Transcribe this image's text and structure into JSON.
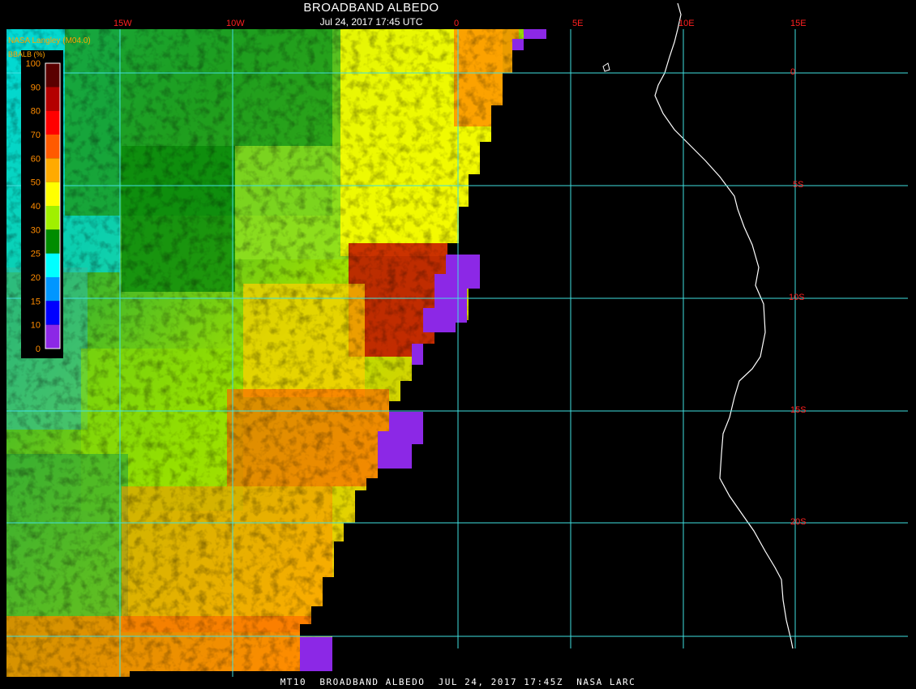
{
  "header": {
    "title": "BROADBAND ALBEDO",
    "timestamp": "Jul 24, 2017 17:45 UTC"
  },
  "credit": "NASA Langley (M04.0)",
  "footer": "MT10  BROADBAND ALBEDO  JUL 24, 2017 17:45Z  NASA LARC",
  "legend": {
    "title": "BBALB (%)",
    "ticks": [
      "100",
      "90",
      "80",
      "70",
      "60",
      "50",
      "40",
      "30",
      "25",
      "20",
      "15",
      "10",
      "0"
    ],
    "colors": [
      "#5a0000",
      "#b40000",
      "#ff0000",
      "#ff5a00",
      "#ffaa00",
      "#ffff00",
      "#a0f000",
      "#008c00",
      "#00ffff",
      "#0096ff",
      "#0000ff",
      "#8c28e6"
    ]
  },
  "grid": {
    "longitudes": [
      "15W",
      "10W",
      "0",
      "5E",
      "10E",
      "15E"
    ],
    "latitudes": [
      "0",
      "5S",
      "10S",
      "15S",
      "20S"
    ],
    "line_color": "#40e0e0"
  },
  "colors": {
    "coastline": "#ffffff",
    "no_data_fill": "#8c28e6",
    "background": "#000000"
  }
}
